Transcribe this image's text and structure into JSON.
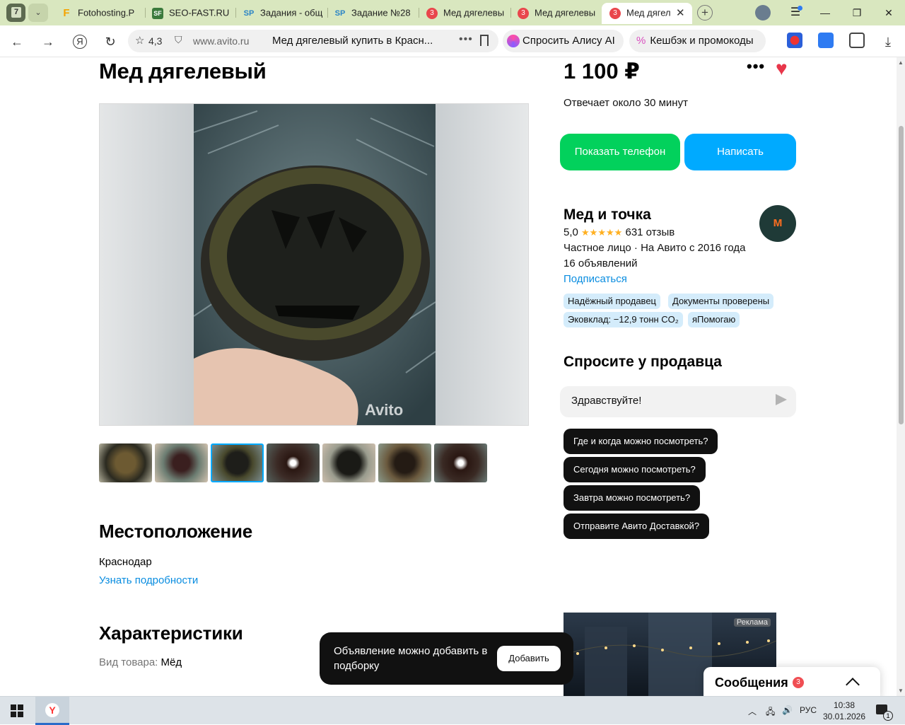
{
  "browser": {
    "tab_count": "7",
    "tabs": [
      {
        "label": "Fotohosting.P",
        "icon": "F"
      },
      {
        "label": "SEO-FAST.RU",
        "icon": "SF"
      },
      {
        "label": "Задания - общ",
        "icon": "SP"
      },
      {
        "label": "Задание №28",
        "icon": "SP"
      },
      {
        "label": "Мед дягелевы",
        "badge": "3"
      },
      {
        "label": "Мед дягелевы",
        "badge": "3"
      },
      {
        "label": "Мед дягел",
        "badge": "3",
        "active": true
      }
    ],
    "rating": "4,3",
    "domain": "www.avito.ru",
    "page_title": "Мед дягелевый купить в Красн...",
    "alice_label": "Спросить Алису AI",
    "cashback_label": "Кешбэк и промокоды"
  },
  "listing": {
    "title": "Мед дягелевый",
    "price": "1 100 ₽",
    "reply_time": "Отвечает около 30 минут",
    "show_phone": "Показать телефон",
    "write": "Написать",
    "watermark": "Avito"
  },
  "seller": {
    "name": "Мед и точка",
    "rating": "5,0",
    "stars": "★★★★★",
    "reviews": "631 отзыв",
    "type": "Частное лицо · На Авито с 2016 года",
    "listings": "16 объявлений",
    "subscribe": "Подписаться",
    "badges": [
      "Надёжный продавец",
      "Документы проверены",
      "Эковклад: −12,9 тонн CO₂",
      "яПомогаю"
    ]
  },
  "ask": {
    "title": "Спросите у продавца",
    "input_value": "Здравствуйте!",
    "questions": [
      "Где и когда можно посмотреть?",
      "Сегодня можно посмотреть?",
      "Завтра можно посмотреть?",
      "Отправите Авито Доставкой?"
    ]
  },
  "location": {
    "heading": "Местоположение",
    "city": "Краснодар",
    "more": "Узнать подробности"
  },
  "specs": {
    "heading": "Характеристики",
    "key": "Вид товара:",
    "value": "Мёд"
  },
  "ad": {
    "label": "Реклама"
  },
  "toast": {
    "message": "Объявление можно добавить в подборку",
    "button": "Добавить"
  },
  "messages": {
    "label": "Сообщения",
    "count": "3"
  },
  "taskbar": {
    "lang": "РУС",
    "time": "10:38",
    "date": "30.01.2026",
    "notif_count": "1"
  }
}
